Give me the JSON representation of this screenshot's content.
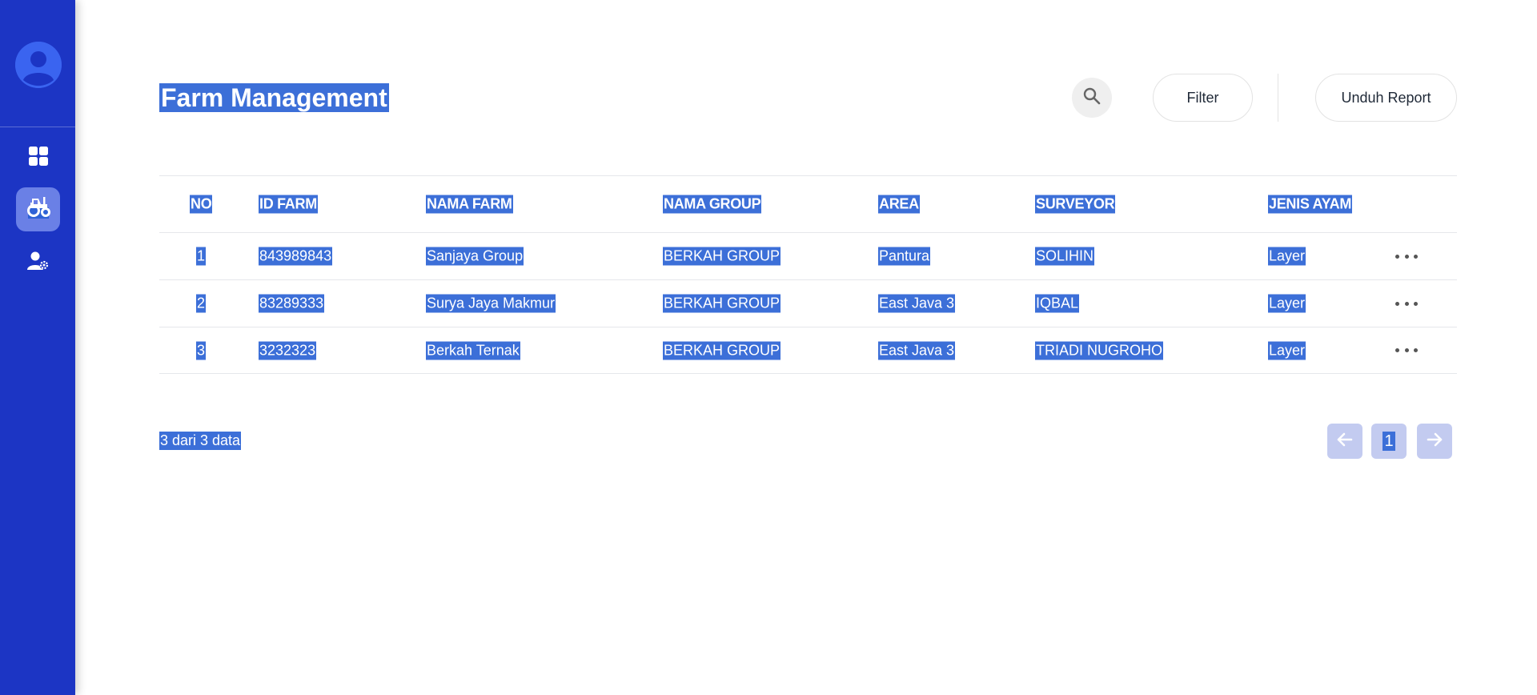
{
  "header": {
    "title": "Farm Management",
    "filter_label": "Filter",
    "report_label": "Unduh Report"
  },
  "table": {
    "columns": [
      "NO",
      "ID FARM",
      "NAMA FARM",
      "NAMA GROUP",
      "AREA",
      "SURVEYOR",
      "JENIS AYAM"
    ],
    "rows": [
      {
        "no": "1",
        "id": "843989843",
        "nama": "Sanjaya Group",
        "group": "BERKAH GROUP",
        "area": "Pantura",
        "surveyor": "SOLIHIN",
        "jenis": "Layer"
      },
      {
        "no": "2",
        "id": "83289333",
        "nama": "Surya Jaya Makmur",
        "group": "BERKAH GROUP",
        "area": "East Java 3",
        "surveyor": "IQBAL",
        "jenis": "Layer"
      },
      {
        "no": "3",
        "id": "3232323",
        "nama": "Berkah Ternak",
        "group": "BERKAH GROUP",
        "area": "East Java 3",
        "surveyor": "TRIADI NUGROHO",
        "jenis": "Layer"
      }
    ]
  },
  "footer": {
    "count_text": "3 dari 3 data",
    "current_page": "1"
  },
  "icons": {
    "avatar": "user-avatar-icon",
    "dashboard": "dashboard-grid-icon",
    "farm": "tractor-icon",
    "users": "user-settings-icon",
    "search": "search-icon",
    "more": "more-horizontal-icon",
    "prev": "arrow-left-icon",
    "next": "arrow-right-icon"
  },
  "colors": {
    "sidebar": "#1c35c4",
    "active_nav": "#6a80e6",
    "selection": "#3c6fd8",
    "pagination": "#c3cbf0"
  }
}
